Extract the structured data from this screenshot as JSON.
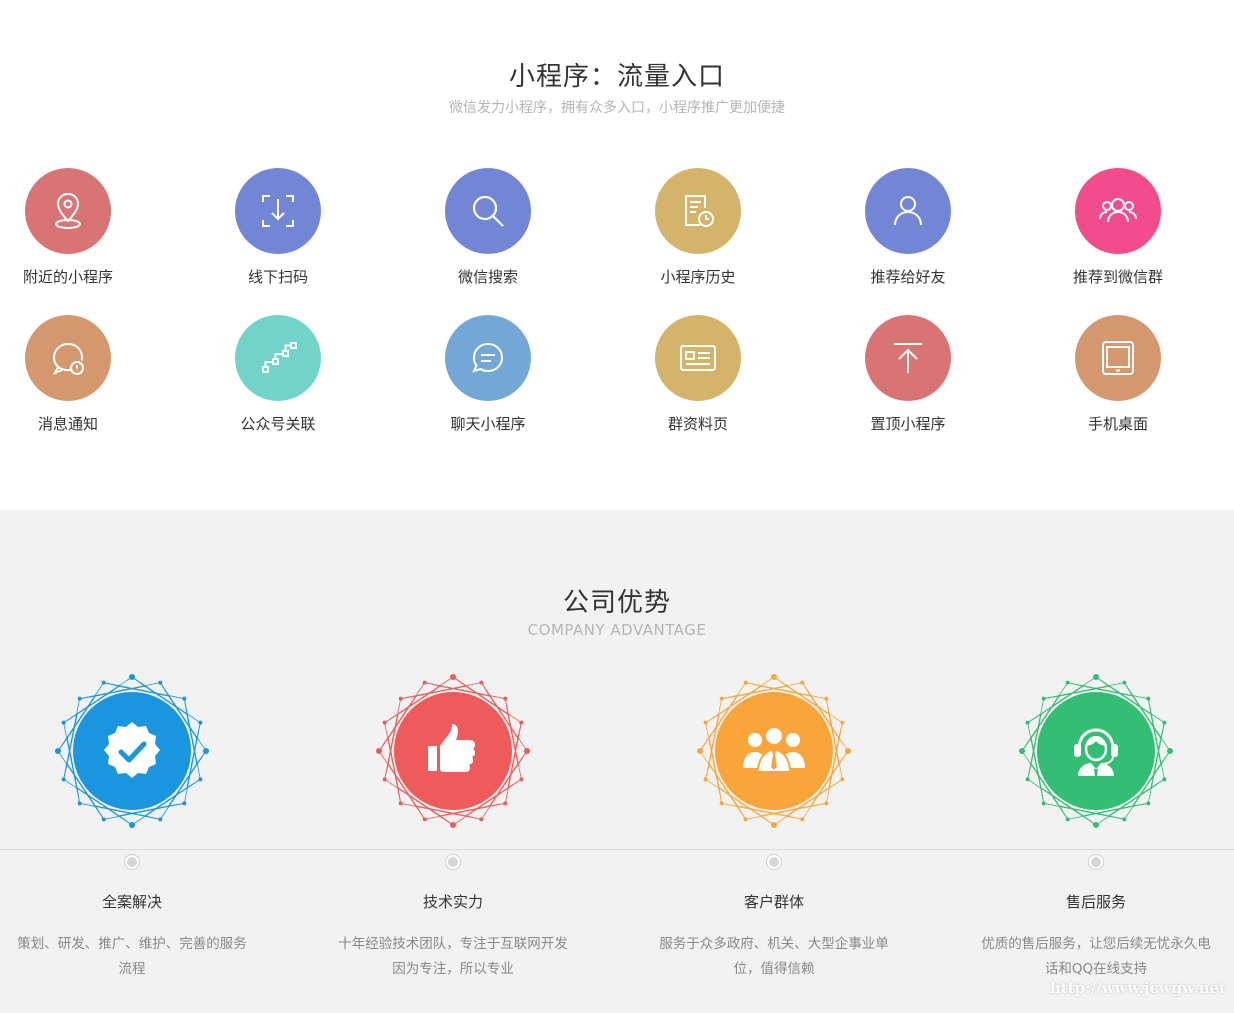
{
  "entry_section": {
    "title": "小程序：流量入口",
    "subtitle": "微信发力小程序，拥有众多入口，小程序推广更加便捷",
    "items": [
      {
        "label": "附近的小程序",
        "icon": "location-pin-icon",
        "color": "#d87474"
      },
      {
        "label": "线下扫码",
        "icon": "scan-icon",
        "color": "#7386d5"
      },
      {
        "label": "微信搜索",
        "icon": "search-icon",
        "color": "#7386d5"
      },
      {
        "label": "小程序历史",
        "icon": "history-icon",
        "color": "#d4b36a"
      },
      {
        "label": "推荐给好友",
        "icon": "user-icon",
        "color": "#7386d5"
      },
      {
        "label": "推荐到微信群",
        "icon": "group-icon",
        "color": "#f24c8a"
      },
      {
        "label": "消息通知",
        "icon": "notification-bubble-icon",
        "color": "#d4976e"
      },
      {
        "label": "公众号关联",
        "icon": "link-steps-icon",
        "color": "#72d4c8"
      },
      {
        "label": "聊天小程序",
        "icon": "chat-icon",
        "color": "#73a8d6"
      },
      {
        "label": "群资料页",
        "icon": "profile-card-icon",
        "color": "#d4b36a"
      },
      {
        "label": "置顶小程序",
        "icon": "pin-top-icon",
        "color": "#d87474"
      },
      {
        "label": "手机桌面",
        "icon": "tablet-icon",
        "color": "#d4976e"
      }
    ]
  },
  "advantage_section": {
    "title": "公司优势",
    "subtitle": "COMPANY ADVANTAGE",
    "items": [
      {
        "name": "全案解决",
        "desc": "策划、研发、推广、维护、完善的服务流程",
        "icon": "verified-badge-icon",
        "color": "#1a96de"
      },
      {
        "name": "技术实力",
        "desc": "十年经验技术团队，专注于互联网开发因为专注，所以专业",
        "icon": "thumbs-up-icon",
        "color": "#ef5a5a"
      },
      {
        "name": "客户群体",
        "desc": "服务于众多政府、机关、大型企事业单位，值得信赖",
        "icon": "business-people-icon",
        "color": "#f9a53a"
      },
      {
        "name": "售后服务",
        "desc": "优质的售后服务，让您后续无忧永久电话和QQ在线支持",
        "icon": "headset-support-icon",
        "color": "#34be74"
      }
    ]
  },
  "watermark": "http://www.jcwgw.net"
}
